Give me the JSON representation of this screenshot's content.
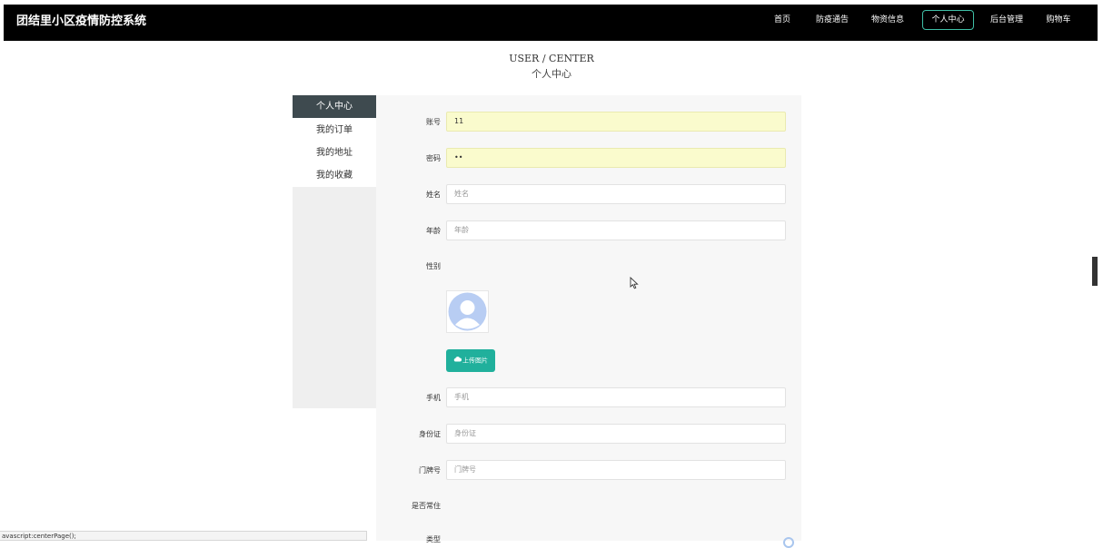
{
  "header": {
    "brand": "团结里小区疫情防控系统",
    "nav": [
      "首页",
      "防疫通告",
      "物资信息",
      "个人中心",
      "后台管理",
      "购物车"
    ],
    "active_nav": "个人中心"
  },
  "page": {
    "title_en": "USER / CENTER",
    "title_cn": "个人中心"
  },
  "sidebar": {
    "items": [
      "个人中心",
      "我的订单",
      "我的地址",
      "我的收藏"
    ],
    "active": "个人中心"
  },
  "form": {
    "account": {
      "label": "账号",
      "value": "11"
    },
    "password": {
      "label": "密码",
      "value": "••"
    },
    "name": {
      "label": "姓名",
      "placeholder": "姓名"
    },
    "age": {
      "label": "年龄",
      "placeholder": "年龄"
    },
    "gender": {
      "label": "性别"
    },
    "upload_label": "上传图片",
    "phone": {
      "label": "手机",
      "placeholder": "手机"
    },
    "id_card": {
      "label": "身份证",
      "placeholder": "身份证"
    },
    "door_no": {
      "label": "门牌号",
      "placeholder": "门牌号"
    },
    "resident": {
      "label": "是否常住"
    },
    "category": {
      "label": "类型"
    }
  },
  "status_bar": "avascript:centerPage();",
  "colors": {
    "topbar": "#000000",
    "accent": "#20b09c",
    "sidebar_active": "#3e4a4f",
    "filled_input": "#fafbcd"
  }
}
